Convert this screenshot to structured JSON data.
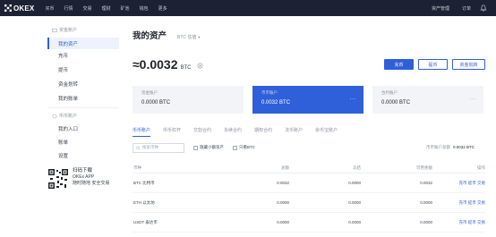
{
  "brand": {
    "name": "OKEX"
  },
  "nav": {
    "items": [
      "买币",
      "行情",
      "交易",
      "理财",
      "矿池",
      "钱包",
      "更多"
    ],
    "right_items": [
      "资产管理",
      "订单"
    ]
  },
  "sidebar": {
    "group1_title": "资金账户",
    "group1_items": [
      {
        "label": "我的资产",
        "active": true
      },
      {
        "label": "充币"
      },
      {
        "label": "提币"
      },
      {
        "label": "资金划转"
      },
      {
        "label": "我的账单"
      }
    ],
    "group2_title": "币币账户",
    "group2_items": [
      {
        "label": "我的入口"
      },
      {
        "label": "账单"
      },
      {
        "label": "设置"
      }
    ],
    "qr": {
      "line1": "扫码下载",
      "line2": "OKEx APP",
      "line3": "随时随地 安全交易"
    }
  },
  "main": {
    "title": "我的资产",
    "currency_select": "BTC 估值",
    "balance_value": "≈0.0032",
    "balance_unit": "BTC",
    "actions": {
      "deposit": "充币",
      "withdraw": "提币",
      "transfer": "资金划转"
    },
    "cards": [
      {
        "label": "资金账户",
        "value": "0.0000",
        "unit": "BTC",
        "active": false,
        "more": ""
      },
      {
        "label": "币币账户",
        "value": "0.0032",
        "unit": "BTC",
        "active": true,
        "more": "···"
      },
      {
        "label": "合约账户",
        "value": "0.0000",
        "unit": "BTC",
        "active": false,
        "more": "···"
      }
    ],
    "tabs": [
      "币币账户",
      "币币杠杆",
      "交割合约",
      "永续合约",
      "期权合约",
      "法币账户",
      "余币宝账户"
    ],
    "search_placeholder": "搜索币种",
    "filter_hide_small": "隐藏小额资产",
    "filter_only": "只看BTC",
    "total_label": "币币账户总额",
    "total_value": "0.0032 BTC",
    "table": {
      "headers": [
        "币种",
        "总额",
        "冻结",
        "可用余额",
        "操作"
      ],
      "rows": [
        {
          "coin": "BTC 比特币",
          "total": "0.0032",
          "frozen": "0.0000",
          "available": "0.0032",
          "action": "充币 提币 交易"
        },
        {
          "coin": "ETH 以太坊",
          "total": "0.0000",
          "frozen": "0.0000",
          "available": "0.0000",
          "action": "充币 提币 交易"
        },
        {
          "coin": "USDT 泰达币",
          "total": "0.0000",
          "frozen": "0.0000",
          "available": "0.0000",
          "action": "充币 提币 交易"
        }
      ]
    }
  }
}
